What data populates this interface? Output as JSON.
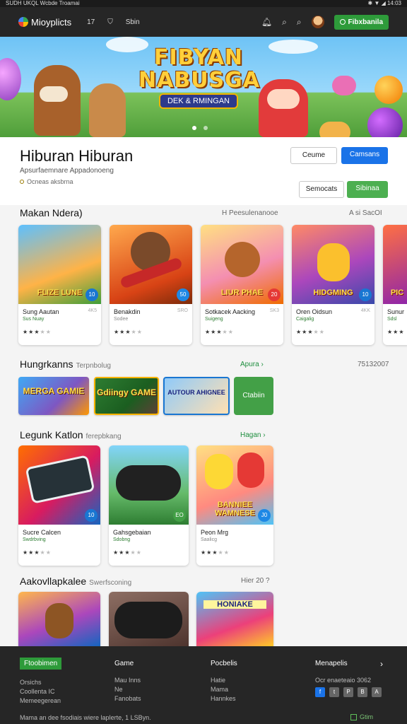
{
  "status": {
    "left": "SUDH UKQL Wcbde Troamai",
    "right": "✱ ▼ ◢ 14:03"
  },
  "nav": {
    "logo": "Mioyplicts",
    "links": [
      "17",
      "Sbin"
    ],
    "signin": "Fibxbanila"
  },
  "hero": {
    "line1": "FIBYAN",
    "line2": "NABUSGA",
    "sub": "DEK & RMINGAN"
  },
  "header": {
    "title": "Hiburan Hiburan",
    "subtitle": "Apsurfaemnare Appadonoeng",
    "meta": "Ocneas aksbrna",
    "btn_outline1": "Ceume",
    "btn_blue": "Camsans",
    "btn_outline2": "Semocats",
    "btn_green": "Sibinaa"
  },
  "sections": {
    "s1": {
      "title": "Makan Ndera)",
      "mid": "H  Peesulenanooe",
      "right": "A si SacOI"
    },
    "s2": {
      "title": "Hungrkanns",
      "sub": "Terpnbolug",
      "link": "Apura ›",
      "right": "75132007"
    },
    "s3": {
      "title": "Legunk Katlon",
      "sub": "ferepbkang",
      "link": "Hagan ›"
    },
    "s4": {
      "title": "Aakovllapkalee",
      "sub": "Swerfsconing",
      "right": "Hier 20 ?"
    }
  },
  "row1": [
    {
      "name": "Sung Aautan",
      "tag": "4K5",
      "cat": "Sus Nuay",
      "art": "FLIZE LUNE",
      "badge": "10"
    },
    {
      "name": "Benakdin",
      "tag": "SRO",
      "cat": "Sodee",
      "art": "",
      "badge": "50"
    },
    {
      "name": "Sotkacek Aacking",
      "tag": "SK3",
      "cat": "Suigeng",
      "art": "LIUR PHAE",
      "badge": "20"
    },
    {
      "name": "Oren Oidsun",
      "tag": "4KK",
      "cat": "Caigalig",
      "art": "HIDGMING",
      "badge": "10"
    },
    {
      "name": "Sunur",
      "tag": "",
      "cat": "Sdsl",
      "art": "PIC",
      "badge": ""
    }
  ],
  "promos": [
    {
      "text": "MERGA GAMIE"
    },
    {
      "text": "Gdiingy GAME"
    },
    {
      "text": "AUTOUR AHIGNEE"
    }
  ],
  "promo_more": "Ctabiin",
  "row3": [
    {
      "name": "Sucre Calcen",
      "cat": "Swdrbving",
      "badge": "10"
    },
    {
      "name": "Gahsgebaian",
      "cat": "Sdobng",
      "badge": "EO"
    },
    {
      "name": "Peon Mrg",
      "cat": "Saalicg",
      "art": "BANNIEE WAMNESE",
      "badge": "J0"
    }
  ],
  "row4": [
    {
      "art": ""
    },
    {
      "art": ""
    },
    {
      "art": "HONIAKE"
    }
  ],
  "stars_row1": [
    3,
    3,
    3,
    3,
    3
  ],
  "stars_row3": [
    3,
    3,
    3
  ],
  "footer": {
    "col1": {
      "head": "Ftoobimen",
      "items": [
        "Orsichs",
        "Coollenta IC",
        "Memeegerean"
      ]
    },
    "col2": {
      "head": "Game",
      "items": [
        "Mau Inns",
        "Ne",
        "Fanobats"
      ]
    },
    "col3": {
      "head": "Pocbelis",
      "items": [
        "Hatie",
        "Mama",
        "Hannkes"
      ]
    },
    "col4": {
      "head": "Menapelis",
      "items": [
        "Ocr enaeteaio 3062"
      ]
    },
    "social": [
      "f",
      "t",
      "P",
      "B",
      "A"
    ],
    "copyright": "Mama an dee fsodiais wiere laplerte, 1 LSByn.",
    "store": "Gtim"
  },
  "colors": {
    "accent_green": "#2e9b3a",
    "accent_blue": "#1a73e8",
    "nav_bg": "#262626"
  }
}
